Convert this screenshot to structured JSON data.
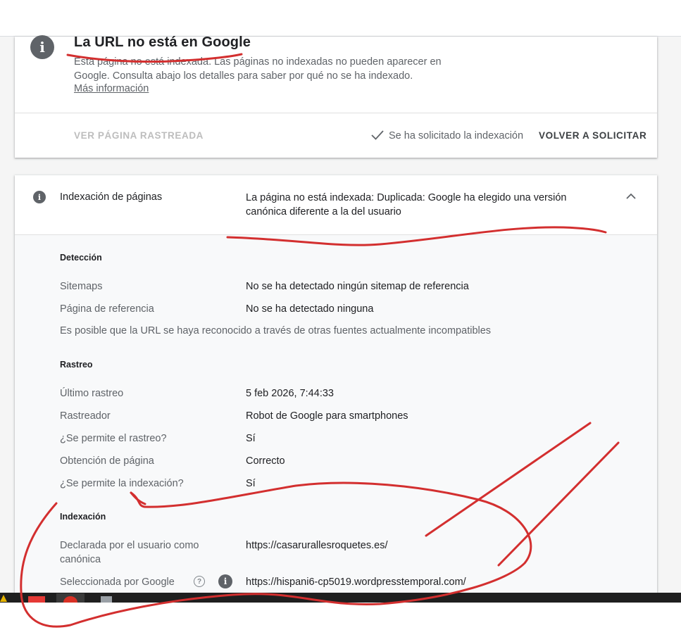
{
  "status_card": {
    "title": "La URL no está en Google",
    "description": "Esta página no está indexada. Las páginas no indexadas no pueden aparecer en Google. Consulta abajo los detalles para saber por qué no se ha indexado.",
    "more_info_link": "Más información",
    "view_crawled_button": "VER PÁGINA RASTREADA",
    "indexing_requested_text": "Se ha solicitado la indexación",
    "resubmit_button": "VOLVER A SOLICITAR",
    "icons": {
      "status": "info-icon",
      "requested": "check-icon"
    }
  },
  "indexing_card": {
    "label": "Indexación de páginas",
    "status": "La página no está indexada: Duplicada: Google ha elegido una versión canónica diferente a la del usuario",
    "groups": {
      "detection": {
        "title": "Detección",
        "rows": [
          {
            "label": "Sitemaps",
            "value": "No se ha detectado ningún sitemap de referencia"
          },
          {
            "label": "Página de referencia",
            "value": "No se ha detectado ninguna"
          }
        ],
        "note": "Es posible que la URL se haya reconocido a través de otras fuentes actualmente incompatibles"
      },
      "crawl": {
        "title": "Rastreo",
        "rows": [
          {
            "label": "Último rastreo",
            "value": "5 feb 2026, 7:44:33"
          },
          {
            "label": "Rastreador",
            "value": "Robot de Google para smartphones"
          },
          {
            "label": "¿Se permite el rastreo?",
            "value": "Sí"
          },
          {
            "label": "Obtención de página",
            "value": "Correcto"
          },
          {
            "label": "¿Se permite la indexación?",
            "value": "Sí"
          }
        ]
      },
      "indexing": {
        "title": "Indexación",
        "rows": [
          {
            "label": "Declarada por el usuario como canónica",
            "value": "https://casarurallesroquetes.es/"
          },
          {
            "label": "Seleccionada por Google",
            "value": "https://hispani6-cp5019.wordpresstemporal.com/"
          }
        ]
      }
    },
    "icons": {
      "section": "info-icon",
      "collapse": "chevron-up-icon",
      "help": "help-icon",
      "row_info": "info-icon"
    },
    "icon_glyphs": {
      "help": "?",
      "info": "i"
    }
  },
  "annotation_color": "#d32f2f"
}
